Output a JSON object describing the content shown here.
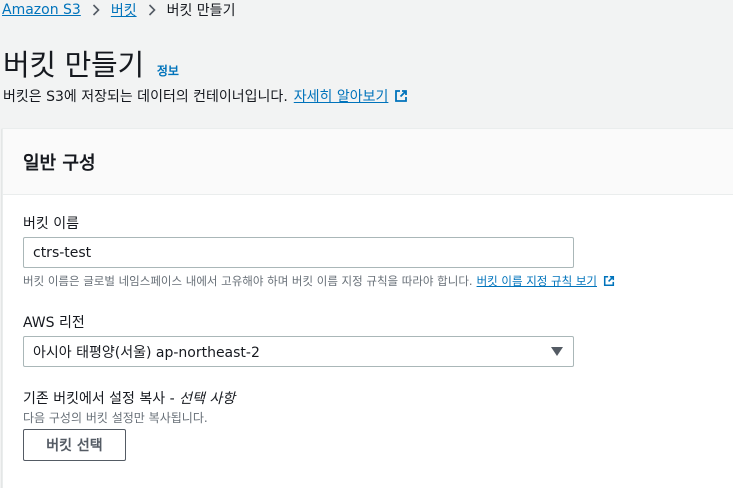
{
  "breadcrumb": {
    "root": "Amazon S3",
    "parent": "버킷",
    "current": "버킷 만들기"
  },
  "header": {
    "title": "버킷 만들기",
    "info_label": "정보",
    "description": "버킷은 S3에 저장되는 데이터의 컨테이너입니다.",
    "learn_more": "자세히 알아보기"
  },
  "panel": {
    "title": "일반 구성",
    "bucket_name": {
      "label": "버킷 이름",
      "value": "ctrs-test",
      "hint": "버킷 이름은 글로벌 네임스페이스 내에서 고유해야 하며 버킷 이름 지정 규칙을 따라야 합니다.",
      "hint_link": "버킷 이름 지정 규칙 보기"
    },
    "region": {
      "label": "AWS 리전",
      "selected": "아시아 태평양(서울) ap-northeast-2"
    },
    "copy_settings": {
      "label": "기존 버킷에서 설정 복사 - ",
      "optional": "선택 사항",
      "hint": "다음 구성의 버킷 설정만 복사됩니다.",
      "button": "버킷 선택"
    }
  },
  "colors": {
    "link": "#0073bb",
    "text": "#16191f",
    "muted": "#687078",
    "page_bg": "#f2f3f3"
  }
}
